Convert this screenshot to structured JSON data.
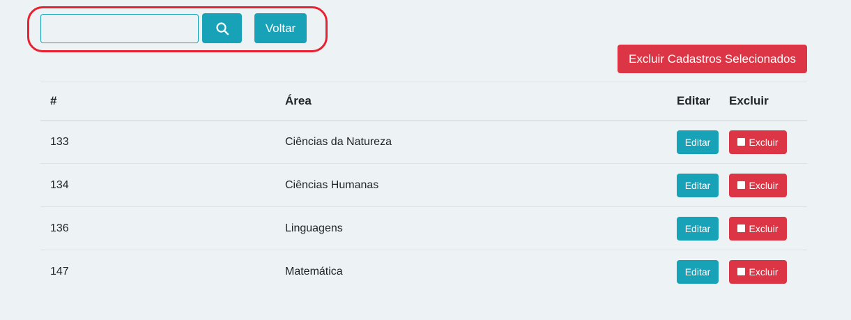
{
  "search": {
    "value": "",
    "placeholder": ""
  },
  "toolbar": {
    "search_icon": "search-icon",
    "back_label": "Voltar",
    "delete_selected_label": "Excluir Cadastros Selecionados"
  },
  "table": {
    "headers": {
      "id": "#",
      "area": "Área",
      "edit": "Editar",
      "delete": "Excluir"
    },
    "rows": [
      {
        "id": "133",
        "area": "Ciências da Natureza",
        "edit_label": "Editar",
        "delete_label": "Excluir"
      },
      {
        "id": "134",
        "area": "Ciências Humanas",
        "edit_label": "Editar",
        "delete_label": "Excluir"
      },
      {
        "id": "136",
        "area": "Linguagens",
        "edit_label": "Editar",
        "delete_label": "Excluir"
      },
      {
        "id": "147",
        "area": "Matemática",
        "edit_label": "Editar",
        "delete_label": "Excluir"
      }
    ]
  },
  "colors": {
    "info": "#17a2b8",
    "danger": "#dc3545",
    "highlight": "#e8202f",
    "background": "#edf3f4"
  }
}
